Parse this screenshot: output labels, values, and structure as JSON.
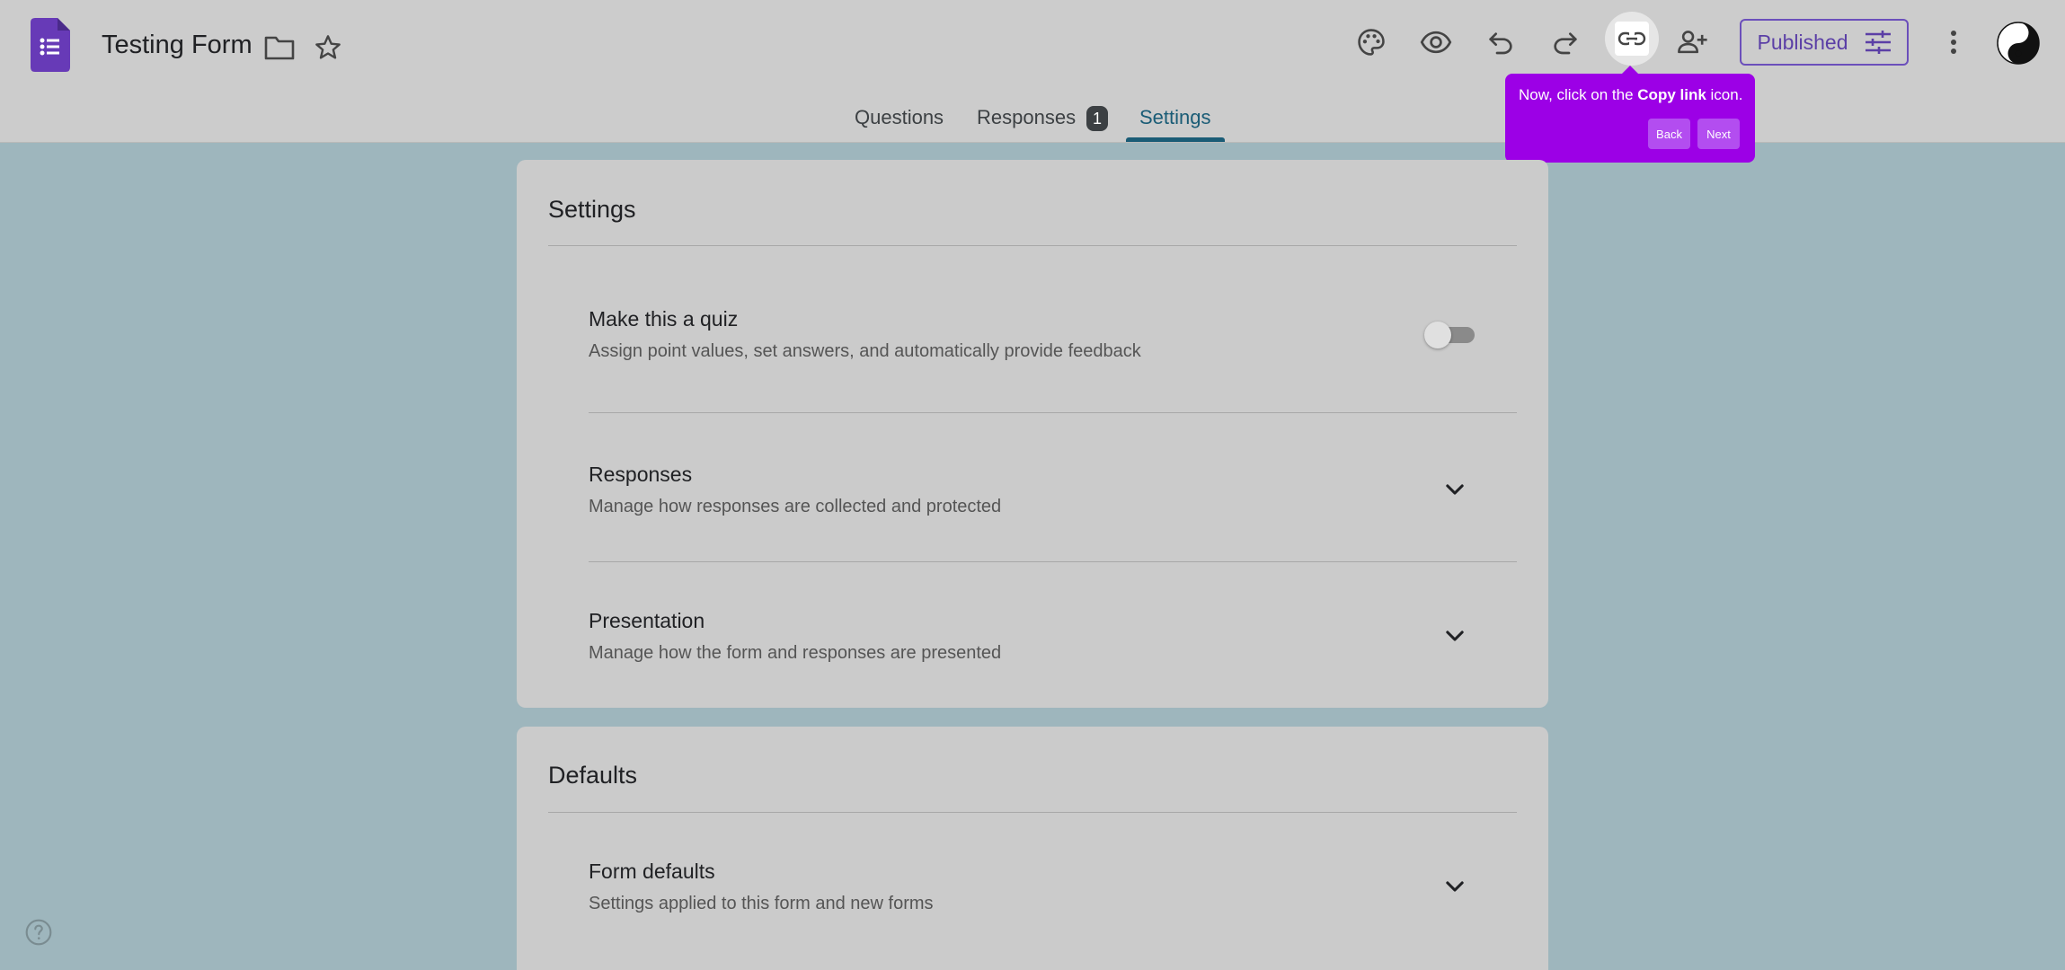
{
  "header": {
    "title": "Testing Form",
    "publish_label": "Published"
  },
  "tabs": [
    {
      "label": "Questions"
    },
    {
      "label": "Responses",
      "badge": "1"
    },
    {
      "label": "Settings",
      "active": true
    }
  ],
  "tooltip": {
    "prefix": "Now, click on the ",
    "bold": "Copy link",
    "suffix": " icon.",
    "back_label": "Back",
    "next_label": "Next"
  },
  "settings_card": {
    "title": "Settings",
    "rows": [
      {
        "title": "Make this a quiz",
        "desc": "Assign point values, set answers, and automatically provide feedback",
        "control": "toggle-off"
      },
      {
        "title": "Responses",
        "desc": "Manage how responses are collected and protected",
        "control": "expand"
      },
      {
        "title": "Presentation",
        "desc": "Manage how the form and responses are presented",
        "control": "expand"
      }
    ]
  },
  "defaults_card": {
    "title": "Defaults",
    "rows": [
      {
        "title": "Form defaults",
        "desc": "Settings applied to this form and new forms",
        "control": "expand"
      }
    ]
  },
  "colors": {
    "accent": "#1a5c76",
    "tooltip": "#9c00e6",
    "forms_purple": "#673ab7"
  },
  "icons": [
    "forms-logo-icon",
    "folder-icon",
    "star-icon",
    "palette-icon",
    "eye-icon",
    "undo-icon",
    "redo-icon",
    "link-icon",
    "add-person-icon",
    "tune-icon",
    "more-vert-icon",
    "yin-yang-avatar",
    "chevron-down-icon",
    "help-icon"
  ]
}
